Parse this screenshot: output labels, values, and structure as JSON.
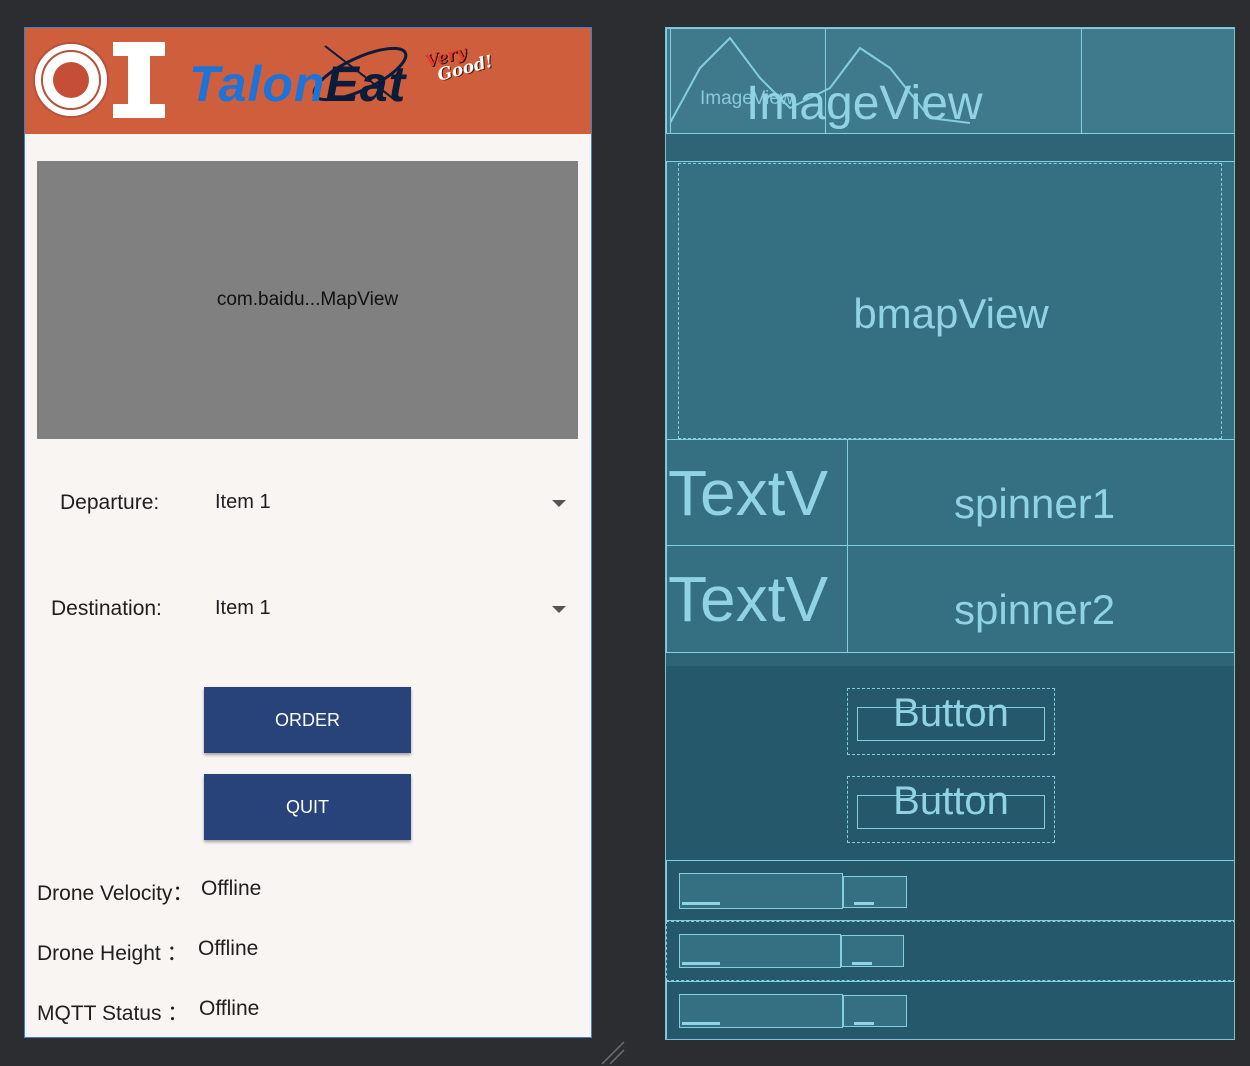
{
  "design": {
    "brand": {
      "name_part1": "Talon",
      "name_part2": "Eat",
      "slogan_line1": "Very",
      "slogan_line2": "Good!"
    },
    "map_view": {
      "label": "com.baidu...MapView"
    },
    "departure": {
      "label": "Departure:",
      "selected": "Item 1"
    },
    "destination": {
      "label": "Destination:",
      "selected": "Item 1"
    },
    "buttons": {
      "order": "ORDER",
      "quit": "QUIT"
    },
    "status": {
      "velocity_label": "Drone Velocity：",
      "velocity_value": "Offline",
      "height_label": "Drone Height ：",
      "height_value": "Offline",
      "mqtt_label": "MQTT Status ：",
      "mqtt_value": "Offline"
    }
  },
  "blueprint": {
    "image_view_small": "ImageView",
    "image_view": "ImageView",
    "map_view": "bmapView",
    "textview_1": "TextV",
    "spinner_1": "spinner1",
    "textview_2": "TextV",
    "spinner_2": "spinner2",
    "button_1": "Button",
    "button_2": "Button"
  },
  "colors": {
    "app_bar": "#cf5f3c",
    "button": "#28427a",
    "map_placeholder": "#808080",
    "blueprint_bg": "#2f6476",
    "blueprint_line": "#82cfe0"
  }
}
